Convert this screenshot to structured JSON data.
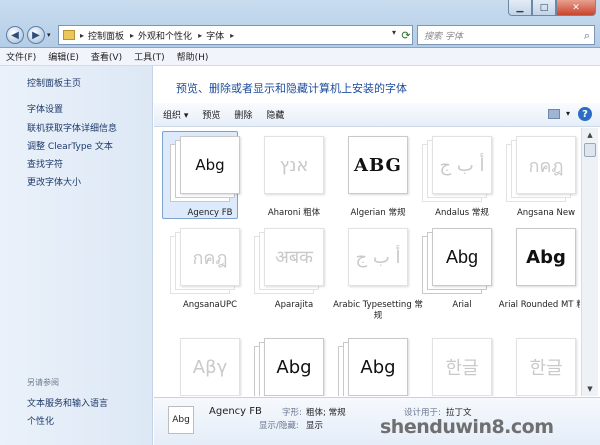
{
  "address": {
    "crumbs": [
      "控制面板",
      "外观和个性化",
      "字体"
    ]
  },
  "search": {
    "placeholder": "搜索 字体"
  },
  "menubar": [
    "文件(F)",
    "编辑(E)",
    "查看(V)",
    "工具(T)",
    "帮助(H)"
  ],
  "leftpane": {
    "links": [
      "控制面板主页",
      "字体设置",
      "联机获取字体详细信息",
      "调整 ClearType 文本",
      "查找字符",
      "更改字体大小"
    ],
    "see_also_title": "另请参阅",
    "see_also": [
      "文本服务和输入语言",
      "个性化"
    ]
  },
  "heading": "预览、删除或者显示和隐藏计算机上安装的字体",
  "toolbar": {
    "organize": "组织 ▾",
    "preview": "预览",
    "delete": "删除",
    "hide": "隐藏"
  },
  "fonts": [
    {
      "name": "Agency FB",
      "sample": "Abg",
      "faded": false,
      "stack": true
    },
    {
      "name": "Aharoni 粗体",
      "sample": "אנץ",
      "faded": true,
      "stack": false
    },
    {
      "name": "Algerian 常规",
      "sample": "ABG",
      "faded": false,
      "stack": false
    },
    {
      "name": "Andalus 常规",
      "sample": "أ ب ج",
      "faded": true,
      "stack": true
    },
    {
      "name": "Angsana New",
      "sample": "กคฎ",
      "faded": true,
      "stack": true
    },
    {
      "name": "AngsanaUPC",
      "sample": "กคฎ",
      "faded": true,
      "stack": true
    },
    {
      "name": "Aparajita",
      "sample": "अबक",
      "faded": true,
      "stack": true
    },
    {
      "name": "Arabic Typesetting 常规",
      "sample": "أ ب ج",
      "faded": true,
      "stack": false
    },
    {
      "name": "Arial",
      "sample": "Abg",
      "faded": false,
      "stack": true
    },
    {
      "name": "Arial Rounded MT 粗体",
      "sample": "Abg",
      "faded": false,
      "stack": false
    },
    {
      "name": "",
      "sample": "Αβγ",
      "faded": true,
      "stack": false
    },
    {
      "name": "",
      "sample": "Abg",
      "faded": false,
      "stack": true
    },
    {
      "name": "",
      "sample": "Abg",
      "faded": false,
      "stack": true
    },
    {
      "name": "",
      "sample": "한글",
      "faded": true,
      "stack": false
    },
    {
      "name": "",
      "sample": "한글",
      "faded": true,
      "stack": false
    }
  ],
  "details": {
    "name": "Agency FB",
    "icon_sample": "Abg",
    "style_label": "字形:",
    "style_value": "粗体; 常规",
    "design_label": "设计用于:",
    "design_value": "拉丁文",
    "show_label": "显示/隐藏:",
    "show_value": "显示"
  },
  "watermark": "shenduwin8.com"
}
